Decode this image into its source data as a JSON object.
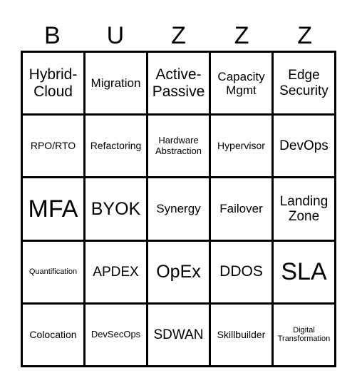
{
  "header": {
    "letters": [
      "B",
      "U",
      "Z",
      "Z",
      "Z"
    ]
  },
  "board": {
    "rows": [
      [
        "Hybrid-\nCloud",
        "Migration",
        "Active-\nPassive",
        "Capacity\nMgmt",
        "Edge\nSecurity"
      ],
      [
        "RPO/RTO",
        "Refactoring",
        "Hardware\nAbstraction",
        "Hypervisor",
        "DevOps"
      ],
      [
        "MFA",
        "BYOK",
        "Synergy",
        "Failover",
        "Landing\nZone"
      ],
      [
        "Quantification",
        "APDEX",
        "OpEx",
        "DDOS",
        "SLA"
      ],
      [
        "Colocation",
        "DevSecOps",
        "SDWAN",
        "Skillbuilder",
        "Digital\nTransformation"
      ]
    ]
  }
}
